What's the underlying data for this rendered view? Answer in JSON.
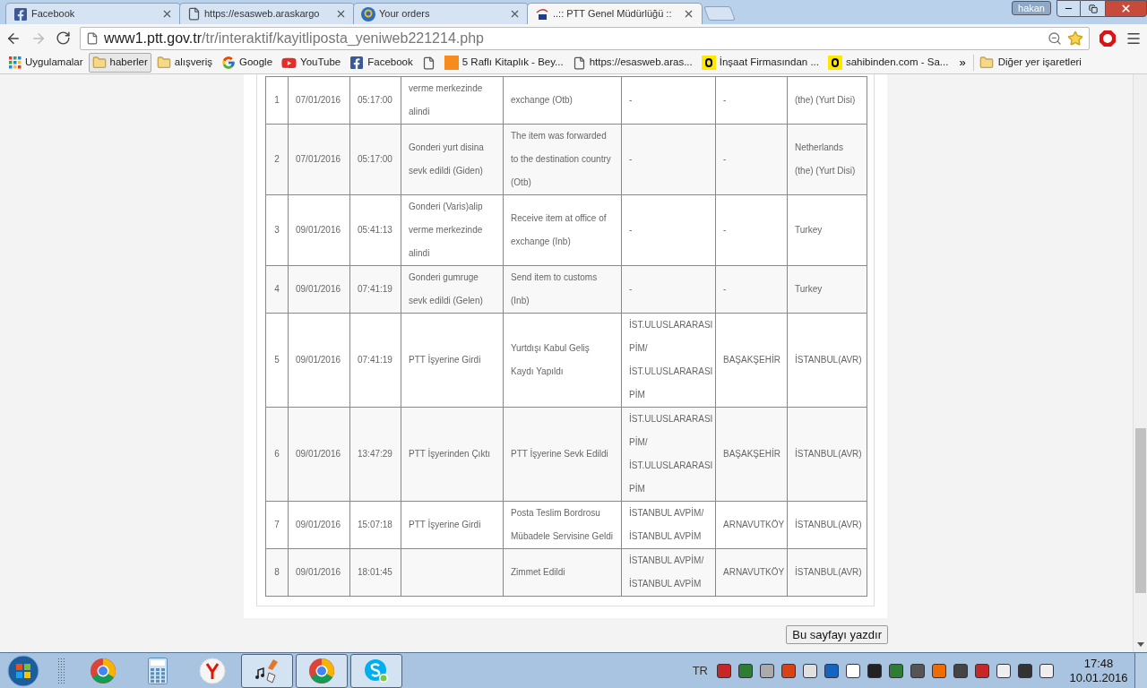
{
  "browser": {
    "tabs": [
      {
        "kind": "facebook",
        "title": "Facebook",
        "selected": false
      },
      {
        "kind": "page",
        "title": "https://esasweb.araskargo",
        "selected": false
      },
      {
        "kind": "g",
        "title": "Your orders",
        "selected": false
      },
      {
        "kind": "ptt",
        "title": "..:: PTT Genel Müdürlüğü ::",
        "selected": true
      }
    ],
    "user": "hakan",
    "address": {
      "host": "www1.ptt.gov.tr",
      "path": "/tr/interaktif/kayitliposta_yeniweb221214.php"
    },
    "bookmarks": [
      {
        "kind": "apps",
        "label": "Uygulamalar",
        "hovered": false
      },
      {
        "kind": "folder",
        "label": "haberler",
        "hovered": true
      },
      {
        "kind": "folder",
        "label": "alışveriş",
        "hovered": false
      },
      {
        "kind": "google",
        "label": "Google",
        "hovered": false
      },
      {
        "kind": "youtube",
        "label": "YouTube",
        "hovered": false
      },
      {
        "kind": "facebook",
        "label": "Facebook",
        "hovered": false
      },
      {
        "kind": "page",
        "hovered": false
      },
      {
        "kind": "hb",
        "label": "5 Raflı Kitaplık - Bey...",
        "hovered": false
      },
      {
        "kind": "page",
        "label": "https://esasweb.aras...",
        "hovered": false
      },
      {
        "kind": "s",
        "label": "İnşaat Firmasından ...",
        "hovered": false
      },
      {
        "kind": "s",
        "label": "sahibinden.com - Sa...",
        "hovered": false
      }
    ],
    "more": "»",
    "other_bookmarks": "Diğer yer işaretleri"
  },
  "table": {
    "rows": [
      [
        "1",
        "07/01/2016",
        "05:17:00",
        "verme merkezinde alindi",
        "exchange (Otb)",
        "-",
        "-",
        "(the) (Yurt Disi)"
      ],
      [
        "2",
        "07/01/2016",
        "05:17:00",
        "Gonderi yurt disina sevk edildi (Giden)",
        "The item was forwarded to the destination country (Otb)",
        "-",
        "-",
        "Netherlands (the) (Yurt Disi)"
      ],
      [
        "3",
        "09/01/2016",
        "05:41:13",
        "Gonderi (Varis)alip verme merkezinde alindi",
        "Receive item at office of exchange (Inb)",
        "-",
        "-",
        "Turkey"
      ],
      [
        "4",
        "09/01/2016",
        "07:41:19",
        "Gonderi gumruge sevk edildi (Gelen)",
        "Send item to customs (Inb)",
        "-",
        "-",
        "Turkey"
      ],
      [
        "5",
        "09/01/2016",
        "07:41:19",
        "PTT İşyerine Girdi",
        "Yurtdışı Kabul Geliş Kaydı Yapıldı",
        "İST.ULUSLARARASI PİM/ İST.ULUSLARARASI PİM",
        "BAŞAKŞEHİR",
        "İSTANBUL(AVR)"
      ],
      [
        "6",
        "09/01/2016",
        "13:47:29",
        "PTT İşyerinden Çıktı",
        "PTT İşyerine Sevk Edildi",
        "İST.ULUSLARARASI PİM/ İST.ULUSLARARASI PİM",
        "BAŞAKŞEHİR",
        "İSTANBUL(AVR)"
      ],
      [
        "7",
        "09/01/2016",
        "15:07:18",
        "PTT İşyerine Girdi",
        "Posta Teslim Bordrosu Mübadele Servisine Geldi",
        "İSTANBUL AVPİM/ İSTANBUL AVPİM",
        "ARNAVUTKÖY",
        "İSTANBUL(AVR)"
      ],
      [
        "8",
        "09/01/2016",
        "18:01:45",
        "",
        "Zimmet Edildi",
        "İSTANBUL AVPİM/ İSTANBUL AVPİM",
        "ARNAVUTKÖY",
        "İSTANBUL(AVR)"
      ]
    ]
  },
  "print_button": "Bu sayfayı yazdır",
  "taskbar": {
    "apps": [
      {
        "kind": "chrome",
        "open": false
      },
      {
        "kind": "calculator",
        "open": false
      },
      {
        "kind": "yandex",
        "open": false
      },
      {
        "kind": "media",
        "open": true
      },
      {
        "kind": "chrome",
        "open": true
      },
      {
        "kind": "skype",
        "open": true
      }
    ],
    "language": "TR",
    "time": "17:48",
    "date": "10.01.2016"
  }
}
